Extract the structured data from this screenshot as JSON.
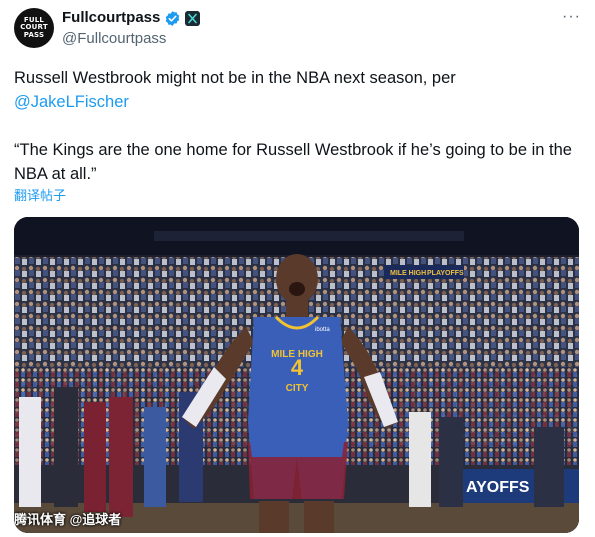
{
  "tweet": {
    "avatar_lines": [
      "FULL",
      "COURT",
      "PASS"
    ],
    "display_name": "Fullcourtpass",
    "handle": "@Fullcourtpass",
    "more_label": "···",
    "text_line1": "Russell Westbrook might not be in the NBA next season, per",
    "mention": "@JakeLFischer",
    "quote": "“The Kings are the one home for Russell Westbrook if he’s going to be in the NBA at all.”",
    "translate_label": "翻译帖子"
  },
  "media": {
    "jersey_top": "MILE HIGH",
    "jersey_bottom": "CITY",
    "jersey_number": "4",
    "sponsor": "ibotta",
    "arena_banner": "MILE HIGH",
    "playoffs_text": "PLAYOFFS",
    "board_text": "AYOFFS",
    "watermark": "腾讯体育 @追球者"
  },
  "colors": {
    "text": "#0f1419",
    "muted": "#536471",
    "link": "#1d9bf0",
    "verified": "#1d9bf0",
    "jersey_blue": "#3a5fb8",
    "jersey_red": "#8b2131"
  },
  "icons": [
    "verified-badge-icon",
    "x-affiliate-icon",
    "more-icon"
  ]
}
